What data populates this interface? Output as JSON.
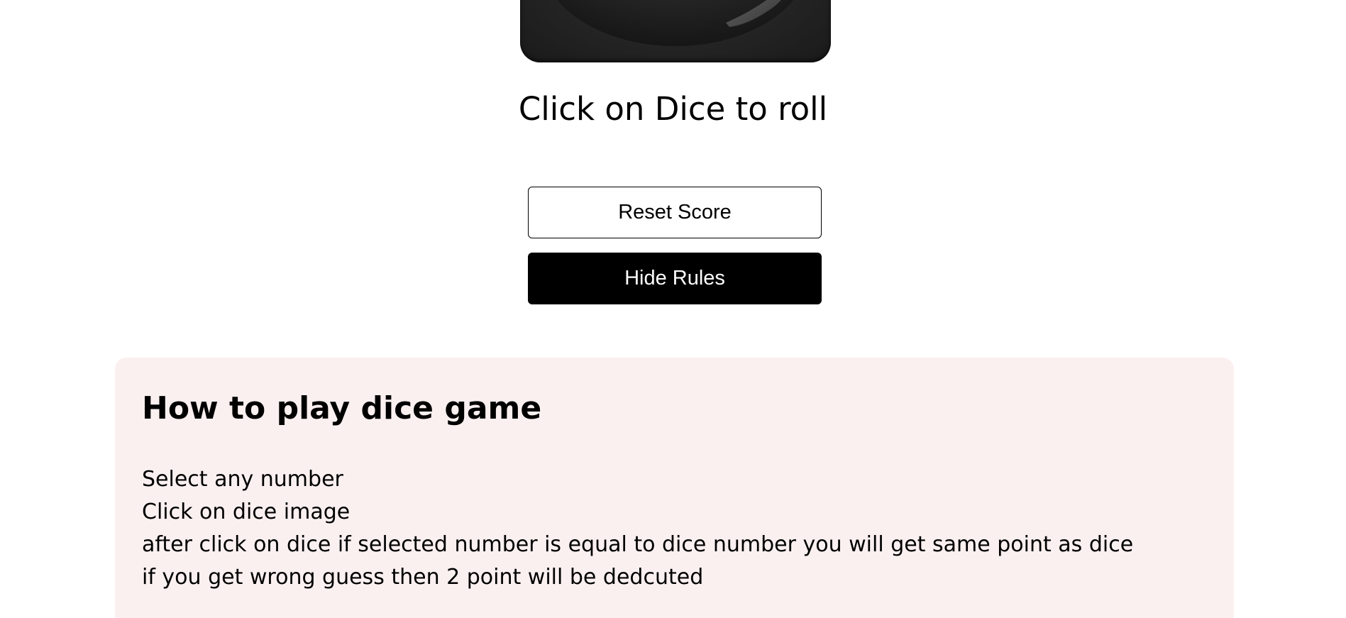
{
  "dice": {
    "icon": "dice-icon"
  },
  "roll_prompt": "Click on Dice to roll",
  "buttons": {
    "reset_label": "Reset Score",
    "rules_label": "Hide Rules"
  },
  "rules": {
    "title": "How to play dice game",
    "items": [
      "Select any number",
      "Click on dice image",
      "after click on dice if selected number is equal to dice number you will get same point as dice",
      "if you get wrong guess then 2 point will be dedcuted"
    ]
  },
  "colors": {
    "rules_background": "#fbf0f0",
    "primary_button": "#000000",
    "dice": "#262626"
  }
}
